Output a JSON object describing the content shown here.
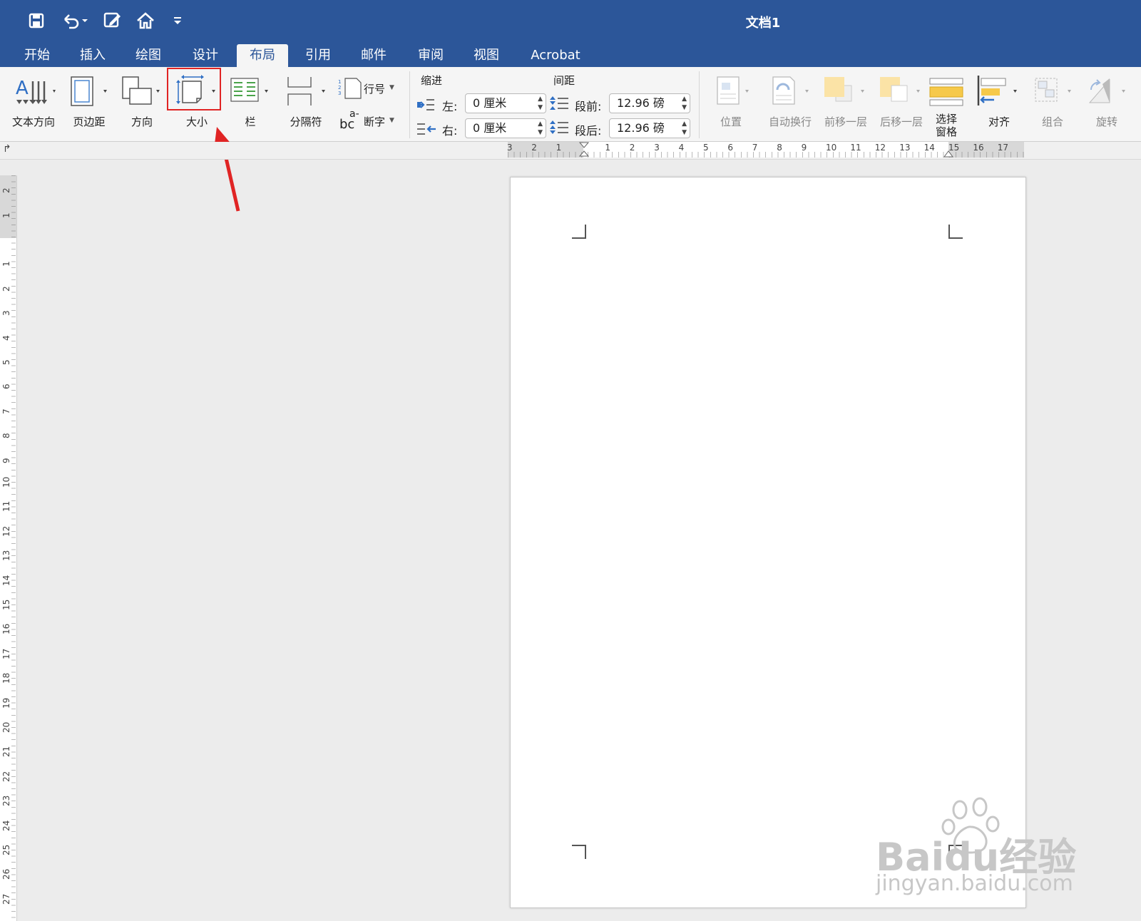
{
  "window": {
    "title": "文档1"
  },
  "quick_access": [
    "save-icon",
    "undo-icon",
    "edit-doc-icon",
    "home-icon",
    "customize-icon"
  ],
  "tabs": [
    {
      "label": "开始"
    },
    {
      "label": "插入"
    },
    {
      "label": "绘图"
    },
    {
      "label": "设计"
    },
    {
      "label": "布局"
    },
    {
      "label": "引用"
    },
    {
      "label": "邮件"
    },
    {
      "label": "审阅"
    },
    {
      "label": "视图"
    },
    {
      "label": "Acrobat"
    }
  ],
  "active_tab": "布局",
  "ribbon": {
    "text_direction": "文本方向",
    "margins": "页边距",
    "orientation": "方向",
    "size": "大小",
    "columns": "栏",
    "breaks": "分隔符",
    "line_numbers": "行号",
    "hyphenation": "断字",
    "hyphen_glyph_top": "a-",
    "hyphen_glyph_bottom": "bc",
    "indent": {
      "title": "缩进",
      "left_label": "左:",
      "left_value": "0 厘米",
      "right_label": "右:",
      "right_value": "0 厘米"
    },
    "spacing": {
      "title": "间距",
      "before_label": "段前:",
      "before_value": "12.96 磅",
      "after_label": "段后:",
      "after_value": "12.96 磅"
    },
    "arrange": {
      "position": "位置",
      "wrap_text": "自动换行",
      "bring_forward": "前移一层",
      "send_backward": "后移一层",
      "selection_pane_line1": "选择",
      "selection_pane_line2": "窗格",
      "align": "对齐",
      "group": "组合",
      "rotate": "旋转"
    },
    "text_dir_glyph": "A"
  },
  "ruler": {
    "horizontal": [
      "3",
      "2",
      "1",
      "1",
      "2",
      "3",
      "4",
      "5",
      "6",
      "7",
      "8",
      "9",
      "10",
      "11",
      "12",
      "13",
      "14",
      "15",
      "16",
      "17"
    ],
    "vertical": [
      "2",
      "1",
      "1",
      "2",
      "3",
      "4",
      "5",
      "6",
      "7",
      "8",
      "9",
      "10",
      "11",
      "12",
      "13",
      "14",
      "15",
      "16",
      "17",
      "18",
      "19",
      "20",
      "21",
      "22",
      "23",
      "24",
      "25",
      "26",
      "27"
    ]
  },
  "watermark": {
    "logo": "Baidu经验",
    "url": "jingyan.baidu.com"
  },
  "colors": {
    "accent": "#2c5699",
    "highlight": "#e02424"
  }
}
